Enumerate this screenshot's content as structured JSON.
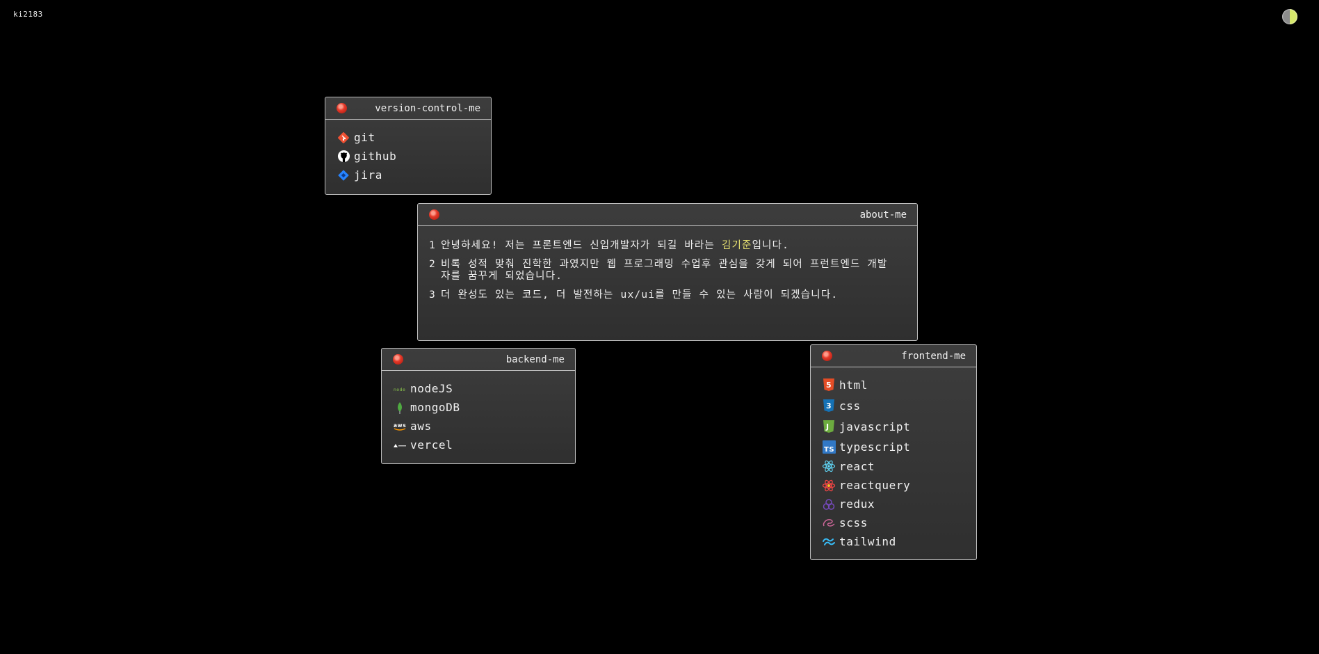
{
  "header": {
    "site_title": "ki2183",
    "theme_toggle": "theme-toggle"
  },
  "version_control": {
    "title": "version-control-me",
    "items": [
      {
        "label": "git",
        "icon": "git-icon"
      },
      {
        "label": "github",
        "icon": "github-icon"
      },
      {
        "label": "jira",
        "icon": "jira-icon"
      }
    ]
  },
  "about": {
    "title": "about-me",
    "lines": [
      {
        "num": "1",
        "before": "안녕하세요! 저는 프론트엔드 신입개발자가 되길 바라는 ",
        "highlight": "김기준",
        "after": "입니다."
      },
      {
        "num": "2",
        "text": "비록 성적 맞춰 진학한 과였지만 웹 프로그래밍 수업후 관심을 갖게 되어 프런트엔드 개발자를 꿈꾸게 되었습니다."
      },
      {
        "num": "3",
        "text": "더 완성도 있는 코드, 더 발전하는 ux/ui를 만들 수 있는 사람이 되겠습니다."
      }
    ]
  },
  "backend": {
    "title": "backend-me",
    "items": [
      {
        "label": "nodeJS",
        "icon": "nodejs-icon"
      },
      {
        "label": "mongoDB",
        "icon": "mongodb-icon"
      },
      {
        "label": "aws",
        "icon": "aws-icon"
      },
      {
        "label": "vercel",
        "icon": "vercel-icon"
      }
    ]
  },
  "frontend": {
    "title": "frontend-me",
    "items": [
      {
        "label": "html",
        "icon": "html5-icon"
      },
      {
        "label": "css",
        "icon": "css3-icon"
      },
      {
        "label": "javascript",
        "icon": "javascript-icon"
      },
      {
        "label": "typescript",
        "icon": "typescript-icon"
      },
      {
        "label": "react",
        "icon": "react-icon"
      },
      {
        "label": "reactquery",
        "icon": "reactquery-icon"
      },
      {
        "label": "redux",
        "icon": "redux-icon"
      },
      {
        "label": "scss",
        "icon": "sass-icon"
      },
      {
        "label": "tailwind",
        "icon": "tailwind-icon"
      }
    ]
  },
  "colors": {
    "background": "#000000",
    "window": "#353535",
    "border": "#bfbfbf",
    "highlight": "#e6e070",
    "close": "#e53a2a"
  }
}
